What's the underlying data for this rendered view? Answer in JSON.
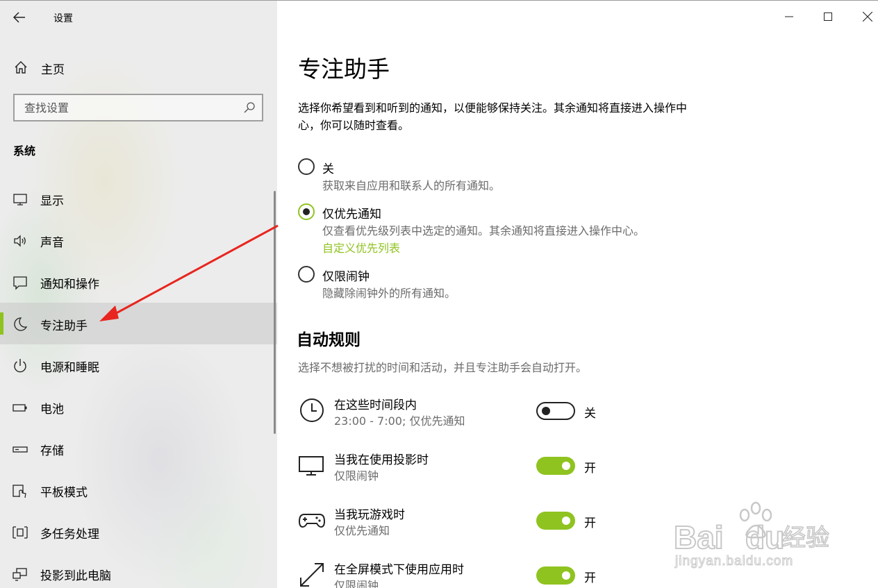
{
  "window": {
    "title": "设置",
    "controls": [
      "minimize",
      "maximize",
      "close"
    ]
  },
  "sidebar": {
    "home_label": "主页",
    "search_placeholder": "查找设置",
    "section": "系统",
    "items": [
      {
        "label": "显示",
        "icon": "monitor-icon"
      },
      {
        "label": "声音",
        "icon": "speaker-icon"
      },
      {
        "label": "通知和操作",
        "icon": "message-icon"
      },
      {
        "label": "专注助手",
        "icon": "moon-icon",
        "active": true
      },
      {
        "label": "电源和睡眠",
        "icon": "power-icon"
      },
      {
        "label": "电池",
        "icon": "battery-icon"
      },
      {
        "label": "存储",
        "icon": "storage-icon"
      },
      {
        "label": "平板模式",
        "icon": "tablet-icon"
      },
      {
        "label": "多任务处理",
        "icon": "multitask-icon"
      },
      {
        "label": "投影到此电脑",
        "icon": "project-icon"
      }
    ]
  },
  "main": {
    "title": "专注助手",
    "intro": "选择你希望看到和听到的通知，以便能够保持关注。其余通知将直接进入操作中心，你可以随时查看。",
    "options": [
      {
        "label": "关",
        "desc": "获取来自应用和联系人的所有通知。",
        "checked": false
      },
      {
        "label": "仅优先通知",
        "desc": "仅查看优先级列表中选定的通知。其余通知将直接进入操作中心。",
        "link": "自定义优先列表",
        "checked": true
      },
      {
        "label": "仅限闹钟",
        "desc": "隐藏除闹钟外的所有通知。",
        "checked": false
      }
    ],
    "auto_rules": {
      "heading": "自动规则",
      "desc": "选择不想被打扰的时间和活动，并且专注助手会自动打开。",
      "rules": [
        {
          "title": "在这些时间段内",
          "sub": "23:00 - 7:00; 仅优先通知",
          "state": "关",
          "on": false,
          "icon": "clock-icon"
        },
        {
          "title": "当我在使用投影时",
          "sub": "仅限闹钟",
          "state": "开",
          "on": true,
          "icon": "projector-monitor-icon"
        },
        {
          "title": "当我玩游戏时",
          "sub": "仅优先通知",
          "state": "开",
          "on": true,
          "icon": "gamepad-icon"
        },
        {
          "title": "在全屏模式下使用应用时",
          "sub": "仅限闹钟",
          "state": "开",
          "on": true,
          "icon": "fullscreen-icon"
        }
      ]
    }
  },
  "watermark": {
    "brand": "Bai",
    "brand2": "du",
    "cn": "经验",
    "url": "jingyan.baidu.com"
  },
  "colors": {
    "accent": "#8fc31f",
    "annotation_arrow": "#e8251f",
    "secondary_text": "#6b6b6b"
  }
}
